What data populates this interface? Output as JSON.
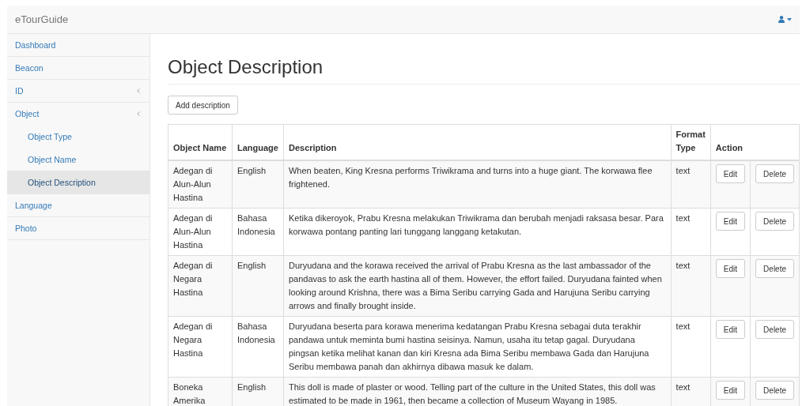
{
  "navbar": {
    "brand": "eTourGuide"
  },
  "sidebar": {
    "items": [
      {
        "label": "Dashboard",
        "kind": "link",
        "selected": false
      },
      {
        "label": "Beacon",
        "kind": "link",
        "selected": false
      },
      {
        "label": "ID",
        "kind": "group",
        "selected": false
      },
      {
        "label": "Object",
        "kind": "group",
        "selected": false,
        "children": [
          {
            "label": "Object Type",
            "selected": false
          },
          {
            "label": "Object Name",
            "selected": false
          },
          {
            "label": "Object Description",
            "selected": true
          }
        ]
      },
      {
        "label": "Language",
        "kind": "link",
        "selected": false
      },
      {
        "label": "Photo",
        "kind": "link",
        "selected": false
      }
    ]
  },
  "page": {
    "title": "Object Description",
    "add_button": "Add description"
  },
  "table": {
    "columns": [
      "Object Name",
      "Language",
      "Description",
      "Format Type",
      "Action"
    ],
    "rows": [
      {
        "object_name": "Adegan di Alun-Alun Hastina",
        "language": "English",
        "description": "When beaten, King Kresna performs Triwikrama and turns into a huge giant. The korwawa flee frightened.",
        "format_type": "text",
        "edit": "Edit",
        "delete": "Delete"
      },
      {
        "object_name": "Adegan di Alun-Alun Hastina",
        "language": "Bahasa Indonesia",
        "description": "Ketika dikeroyok, Prabu Kresna melakukan Triwikrama dan berubah menjadi raksasa besar. Para korwawa pontang panting lari tunggang langgang ketakutan.",
        "format_type": "text",
        "edit": "Edit",
        "delete": "Delete"
      },
      {
        "object_name": "Adegan di Negara Hastina",
        "language": "English",
        "description": "Duryudana and the korawa received the arrival of Prabu Kresna as the last ambassador of the pandavas to ask the earth hastina all of them. However, the effort failed. Duryudana fainted when looking around Krishna, there was a Bima Seribu carrying Gada and Harujuna Seribu carrying arrows and finally brought inside.",
        "format_type": "text",
        "edit": "Edit",
        "delete": "Delete"
      },
      {
        "object_name": "Adegan di Negara Hastina",
        "language": "Bahasa Indonesia",
        "description": "Duryudana beserta para korawa menerima kedatangan Prabu Kresna sebagai duta terakhir pandawa untuk meminta bumi hastina seisinya. Namun, usaha itu tetap gagal. Duryudana pingsan ketika melihat kanan dan kiri Kresna ada Bima Seribu membawa Gada dan Harujuna Seribu membawa panah dan akhirnya dibawa masuk ke dalam.",
        "format_type": "text",
        "edit": "Edit",
        "delete": "Delete"
      },
      {
        "object_name": "Boneka Amerika",
        "language": "English",
        "description": "This doll is made of plaster or wood. Telling part of the culture in the United States, this doll was estimated to be made in 1961, then became a collection of Museum Wayang in 1985.",
        "format_type": "text",
        "edit": "Edit",
        "delete": "Delete"
      }
    ]
  }
}
